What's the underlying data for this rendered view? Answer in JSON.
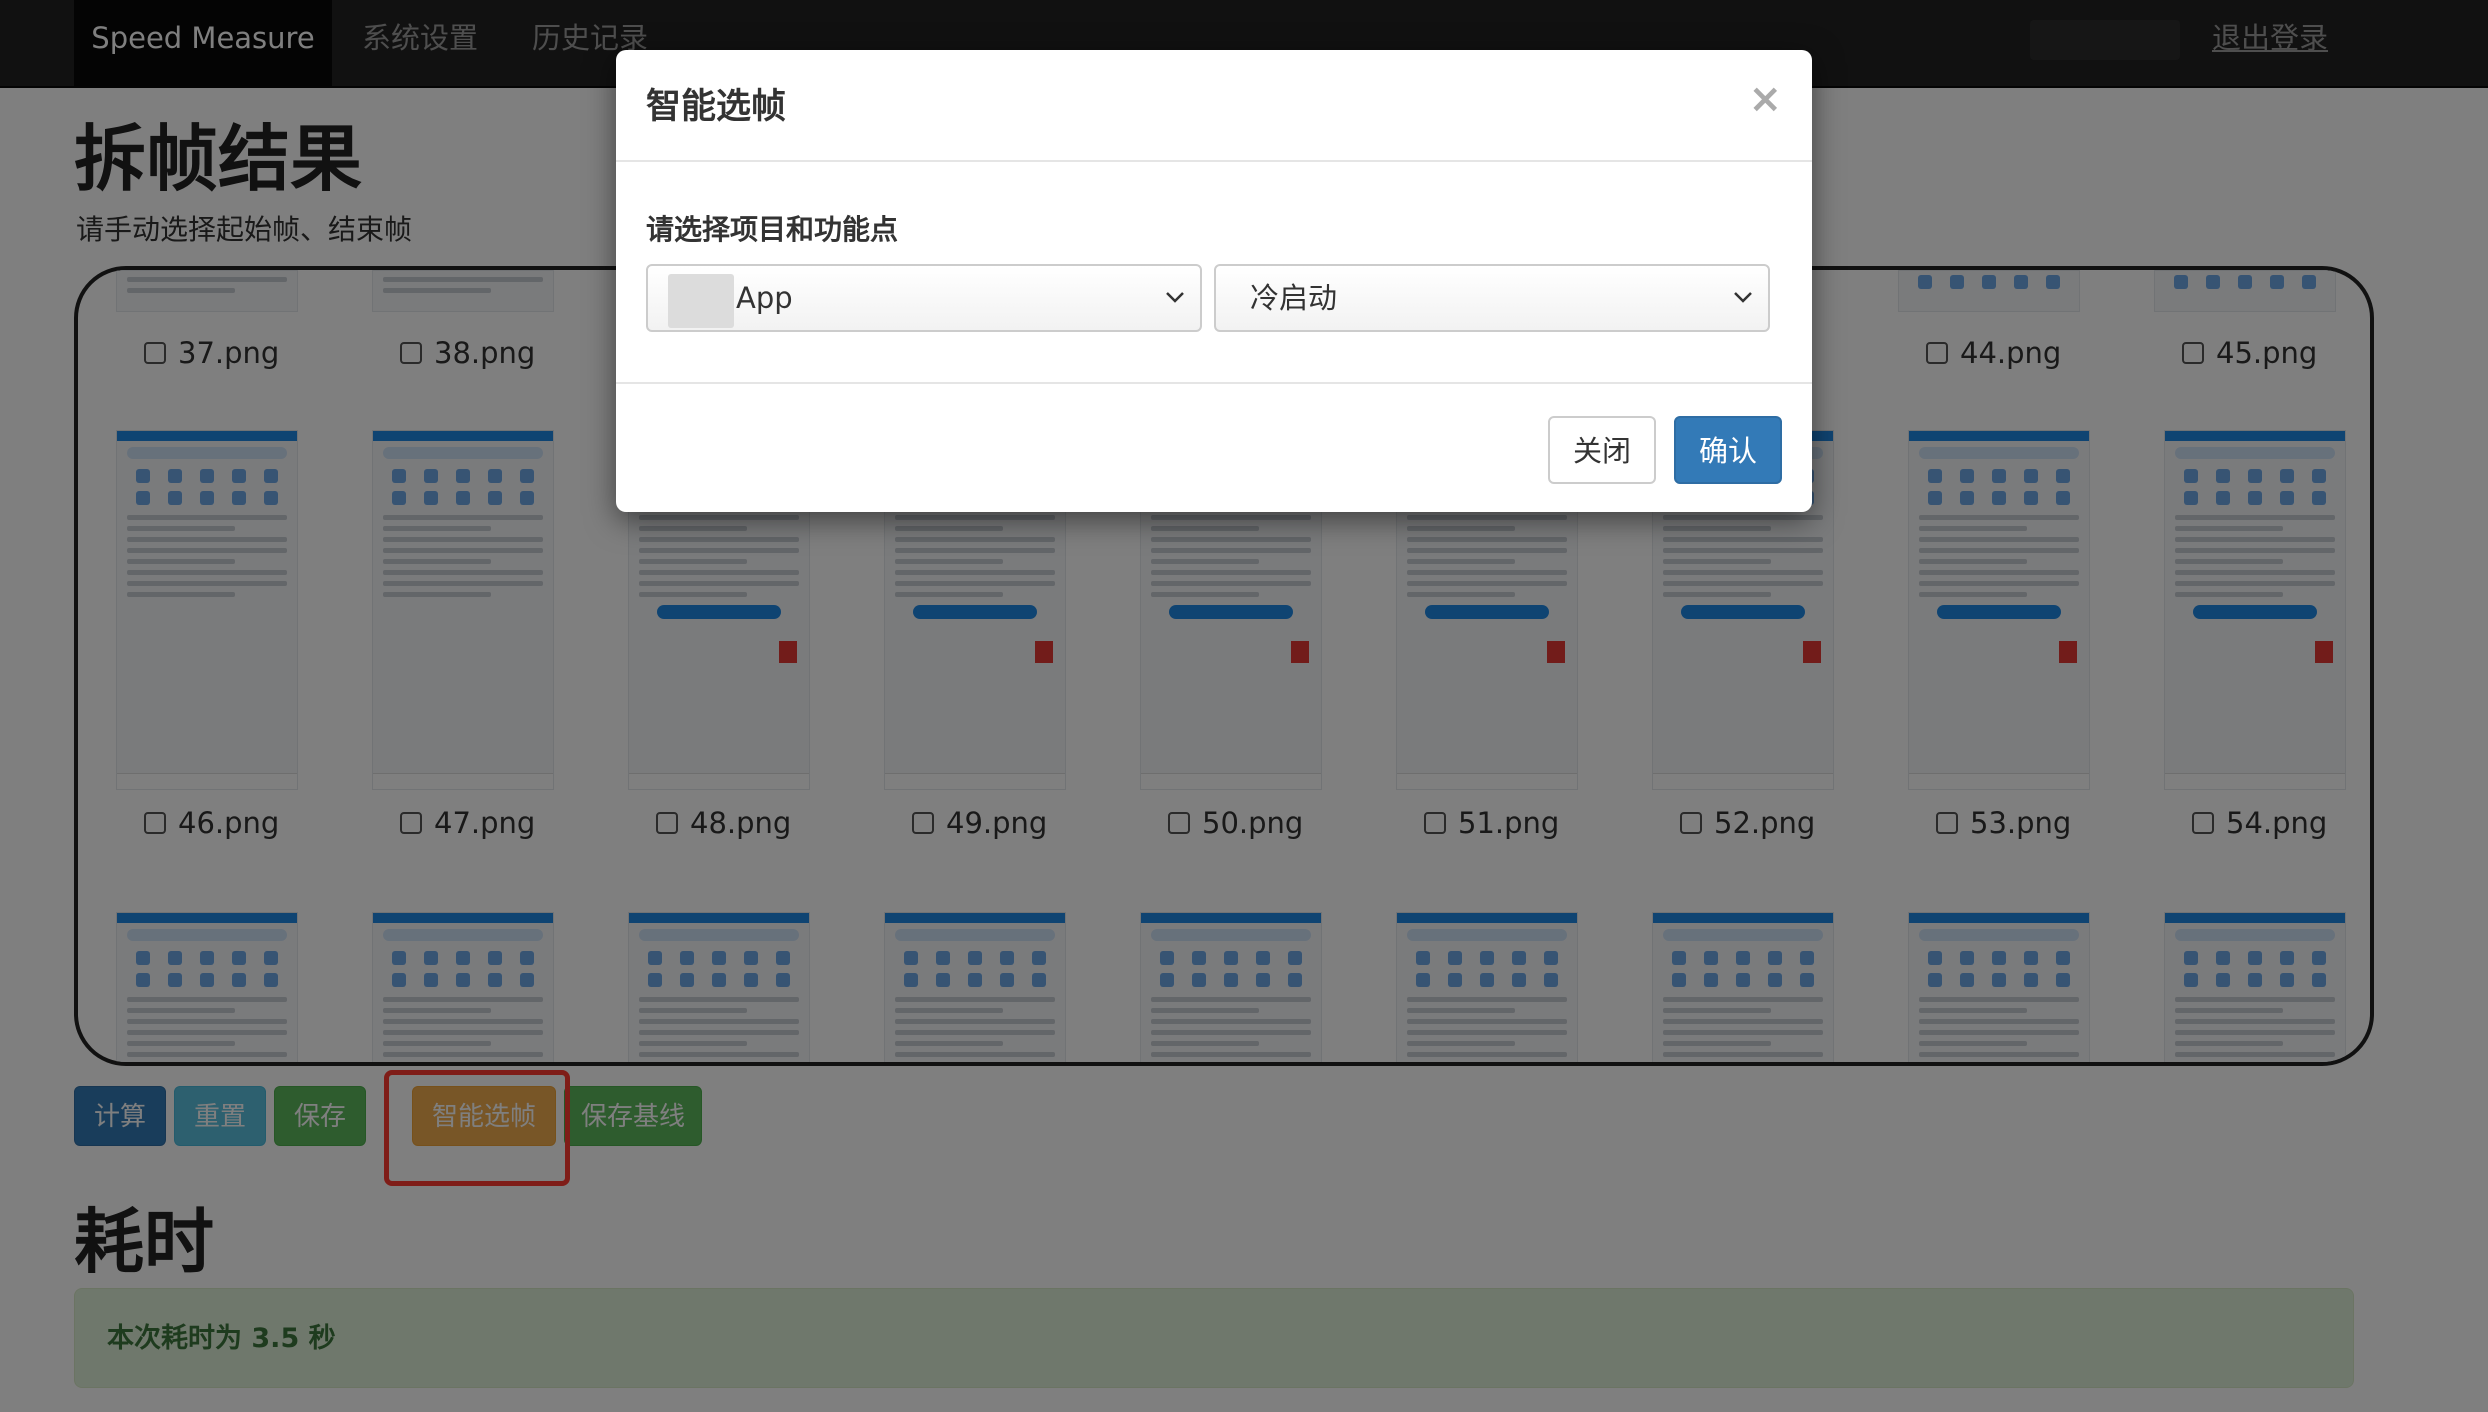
{
  "navbar": {
    "brand": "Speed Measure",
    "items": [
      "系统设置",
      "历史记录"
    ],
    "logout": "退出登录"
  },
  "page": {
    "title": "拆帧结果",
    "subtitle": "请手动选择起始帧、结束帧"
  },
  "frames": {
    "row1_labels": [
      "37.png",
      "38.png",
      "44.png",
      "45.png"
    ],
    "row2_labels": [
      "46.png",
      "47.png",
      "48.png",
      "49.png",
      "50.png",
      "51.png",
      "52.png",
      "53.png",
      "54.png"
    ]
  },
  "actions": {
    "calc": "计算",
    "reset": "重置",
    "save": "保存",
    "smart": "智能选帧",
    "baseline": "保存基线"
  },
  "result": {
    "title": "耗时",
    "message": "本次耗时为 3.5 秒"
  },
  "modal": {
    "title": "智能选帧",
    "close_icon": "×",
    "label": "请选择项目和功能点",
    "project_value": "App",
    "function_value": "冷启动",
    "close_button": "关闭",
    "confirm_button": "确认"
  },
  "colors": {
    "primary": "#337ab7",
    "info": "#5bc0de",
    "success": "#5cb85c",
    "warning": "#f0ad4e",
    "highlight": "#ff3b30"
  }
}
